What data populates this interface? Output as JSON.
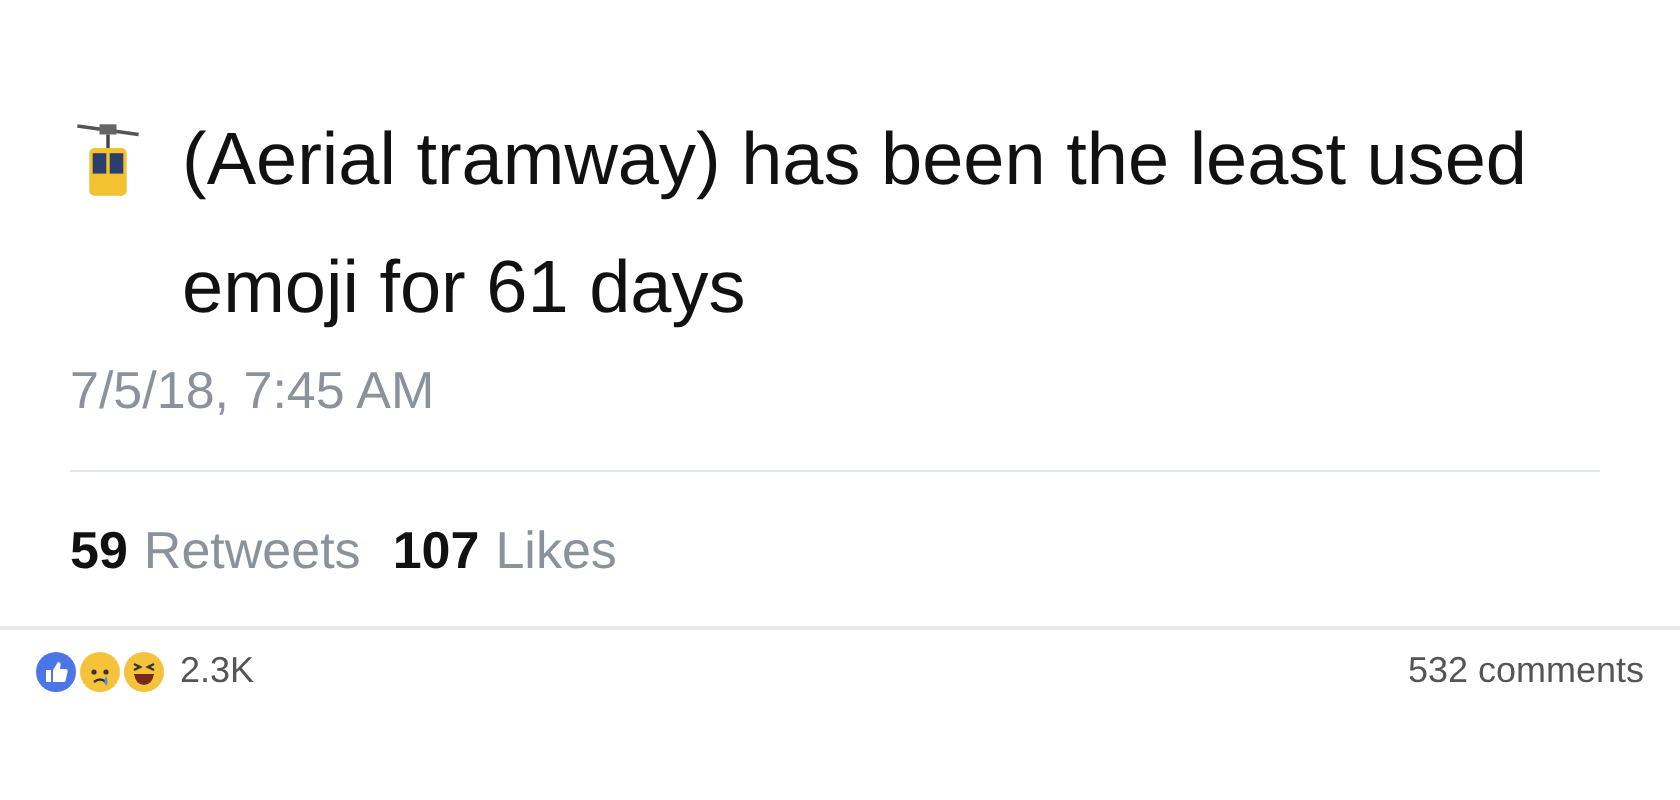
{
  "tweet": {
    "text": "(Aerial tramway) has been the least used emoji for 61 days",
    "timestamp": "7/5/18, 7:45 AM",
    "retweets": {
      "count": "59",
      "label": "Retweets"
    },
    "likes": {
      "count": "107",
      "label": "Likes"
    }
  },
  "post_footer": {
    "reactions_count": "2.3K",
    "comments": "532 comments"
  }
}
